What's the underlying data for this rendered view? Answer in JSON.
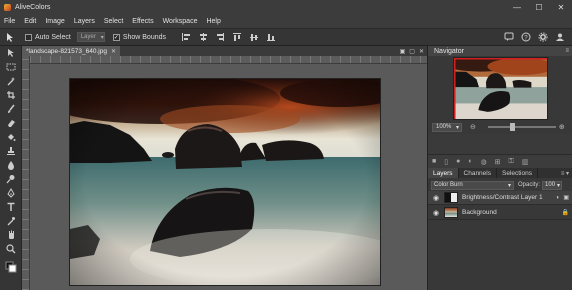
{
  "app": {
    "title": "AliveColors"
  },
  "window_controls": {
    "minimize": "—",
    "maximize": "☐",
    "close": "✕"
  },
  "menu": [
    "File",
    "Edit",
    "Image",
    "Layers",
    "Select",
    "Effects",
    "Workspace",
    "Help"
  ],
  "options_bar": {
    "auto_select_label": "Auto Select",
    "auto_select_checked": false,
    "target_value": "Layer",
    "show_bounds_label": "Show Bounds",
    "show_bounds_checked": true
  },
  "document": {
    "tab_title": "*landscape-821573_640.jpg",
    "close_glyph": "✕"
  },
  "navigator": {
    "title": "Navigator",
    "zoom": "100%"
  },
  "layers_panel": {
    "tabs": [
      "Layers",
      "Channels",
      "Selections"
    ],
    "active_tab": "Layers",
    "blend_mode": "Color Burn",
    "opacity_label": "Opacity:",
    "opacity_value": "100",
    "layers": [
      {
        "name": "Brightness/Contrast Layer 1",
        "visible": true
      },
      {
        "name": "Background",
        "visible": true,
        "locked": true
      }
    ]
  },
  "icons": {
    "tools": [
      "move-icon",
      "marquee-icon",
      "magic-wand-icon",
      "crop-icon",
      "brush-icon",
      "eraser-icon",
      "fill-icon",
      "stamp-icon",
      "smudge-icon",
      "dodge-icon",
      "pen-icon",
      "text-icon",
      "eyedropper-icon",
      "hand-icon",
      "zoom-icon"
    ]
  },
  "colors": {
    "accent": "#4a9cd6",
    "panel_bg": "#383838"
  }
}
